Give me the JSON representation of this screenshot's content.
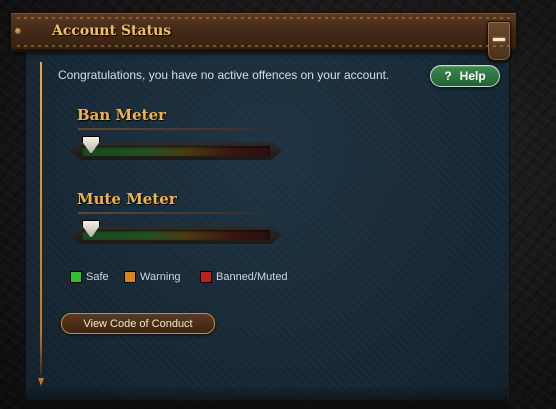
{
  "header": {
    "title": "Account Status",
    "collapse_icon": "minus-icon"
  },
  "status": {
    "message": "Congratulations, you have no active offences on your account."
  },
  "help_button": {
    "icon_text": "?",
    "label": "Help"
  },
  "meters": [
    {
      "title": "Ban Meter",
      "level": 0
    },
    {
      "title": "Mute Meter",
      "level": 0
    }
  ],
  "legend": [
    {
      "label": "Safe",
      "color": "#2fbf2f"
    },
    {
      "label": "Warning",
      "color": "#d9831f"
    },
    {
      "label": "Banned/Muted",
      "color": "#c01f1f"
    }
  ],
  "conduct_button": {
    "label": "View Code of Conduct"
  },
  "colors": {
    "accent_gold": "#f0b24c",
    "panel_bg": "#182a37",
    "help_green": "#2f7a44"
  }
}
